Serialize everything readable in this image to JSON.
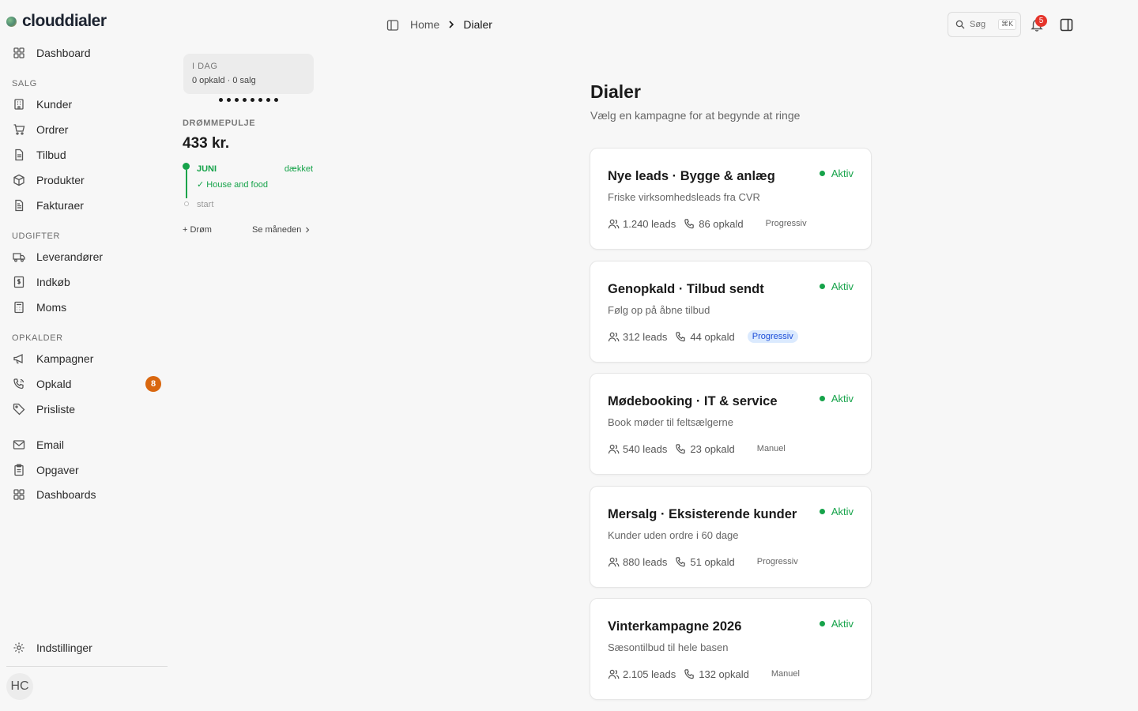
{
  "app": {
    "name": "clouddialer"
  },
  "sidebar": {
    "items": [
      {
        "label": "Dashboard"
      }
    ],
    "sections": [
      {
        "title": "SALG",
        "items": [
          {
            "label": "Kunder"
          },
          {
            "label": "Ordrer"
          },
          {
            "label": "Tilbud"
          },
          {
            "label": "Produkter"
          },
          {
            "label": "Fakturaer"
          }
        ]
      },
      {
        "title": "UDGIFTER",
        "items": [
          {
            "label": "Leverandører"
          },
          {
            "label": "Indkøb"
          },
          {
            "label": "Moms"
          }
        ]
      },
      {
        "title": "OPKALDER",
        "items": [
          {
            "label": "Kampagner"
          },
          {
            "label": "Opkald",
            "badge": "8"
          },
          {
            "label": "Prisliste"
          }
        ]
      }
    ],
    "extra": [
      {
        "label": "Email"
      },
      {
        "label": "Opgaver"
      },
      {
        "label": "Dashboards"
      }
    ],
    "settings_label": "Indstillinger",
    "avatar_initials": "HC"
  },
  "widget": {
    "today_title": "I DAG",
    "today_stats": "0 opkald · 0 salg",
    "dream_label": "DRØMMEPULJE",
    "dream_amount": "433 kr.",
    "timeline": {
      "month": "JUNI",
      "status": "dækket",
      "item": "✓ House and food",
      "start_label": "start"
    },
    "add_dream": "+ Drøm",
    "see_month": "Se måneden"
  },
  "topbar": {
    "breadcrumb_home": "Home",
    "breadcrumb_current": "Dialer",
    "search_placeholder": "Søg",
    "search_shortcut": "⌘K",
    "notifications_count": "5"
  },
  "main": {
    "title": "Dialer",
    "subtitle": "Vælg en kampagne for at begynde at ringe",
    "campaigns": [
      {
        "name": "Nye leads · Bygge & anlæg",
        "description": "Friske virksomhedsleads fra CVR",
        "status": "Aktiv",
        "leads": "1.240 leads",
        "calls": "86 opkald",
        "mode": "Progressiv",
        "mode_highlight": false
      },
      {
        "name": "Genopkald · Tilbud sendt",
        "description": "Følg op på åbne tilbud",
        "status": "Aktiv",
        "leads": "312 leads",
        "calls": "44 opkald",
        "mode": "Progressiv",
        "mode_highlight": true
      },
      {
        "name": "Mødebooking · IT & service",
        "description": "Book møder til feltsælgerne",
        "status": "Aktiv",
        "leads": "540 leads",
        "calls": "23 opkald",
        "mode": "Manuel",
        "mode_highlight": false
      },
      {
        "name": "Mersalg · Eksisterende kunder",
        "description": "Kunder uden ordre i 60 dage",
        "status": "Aktiv",
        "leads": "880 leads",
        "calls": "51 opkald",
        "mode": "Progressiv",
        "mode_highlight": false
      },
      {
        "name": "Vinterkampagne 2026",
        "description": "Sæsontilbud til hele basen",
        "status": "Aktiv",
        "leads": "2.105 leads",
        "calls": "132 opkald",
        "mode": "Manuel",
        "mode_highlight": false
      }
    ]
  },
  "colors": {
    "accent_green": "#16a34a",
    "badge_orange": "#d9670f",
    "notification_red": "#e5342b",
    "highlight_blue": "#dbeafe"
  }
}
